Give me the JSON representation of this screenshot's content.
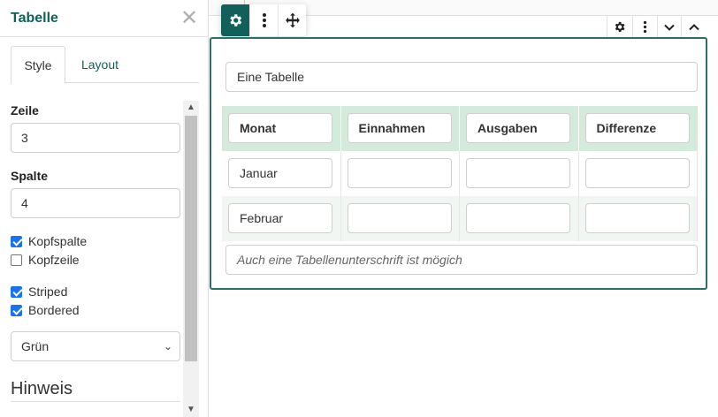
{
  "panel": {
    "title": "Tabelle",
    "close_glyph": "✕",
    "tabs": [
      {
        "label": "Style",
        "active": true
      },
      {
        "label": "Layout",
        "active": false
      }
    ],
    "fields": {
      "zeile_label": "Zeile",
      "zeile_value": "3",
      "spalte_label": "Spalte",
      "spalte_value": "4"
    },
    "checkboxes": [
      {
        "label": "Kopfspalte",
        "checked": true
      },
      {
        "label": "Kopfzeile",
        "checked": false
      },
      {
        "label": "Striped",
        "checked": true
      },
      {
        "label": "Bordered",
        "checked": true
      }
    ],
    "color_select": {
      "value": "Grün"
    },
    "section_heading": "Hinweis"
  },
  "toolbar": {
    "icons": [
      "gear-icon",
      "kebab-menu-icon",
      "move-arrows-icon"
    ]
  },
  "block_toolbar": {
    "icons": [
      "gear-icon",
      "kebab-menu-icon",
      "chevron-down-icon",
      "chevron-up-icon"
    ]
  },
  "table": {
    "title": "Eine Tabelle",
    "headers": [
      "Monat",
      "Einnahmen",
      "Ausgaben",
      "Differenze"
    ],
    "rows": [
      [
        "Januar",
        "",
        "",
        ""
      ],
      [
        "Februar",
        "",
        "",
        ""
      ]
    ],
    "caption_placeholder": "Auch eine Tabellenunterschrift ist mögich"
  },
  "colors": {
    "accent": "#135f5a",
    "block_border": "#2c6e68",
    "header_fill": "#d4eadb",
    "stripe_fill": "#f2f6f3",
    "checkbox": "#1a73e8"
  }
}
